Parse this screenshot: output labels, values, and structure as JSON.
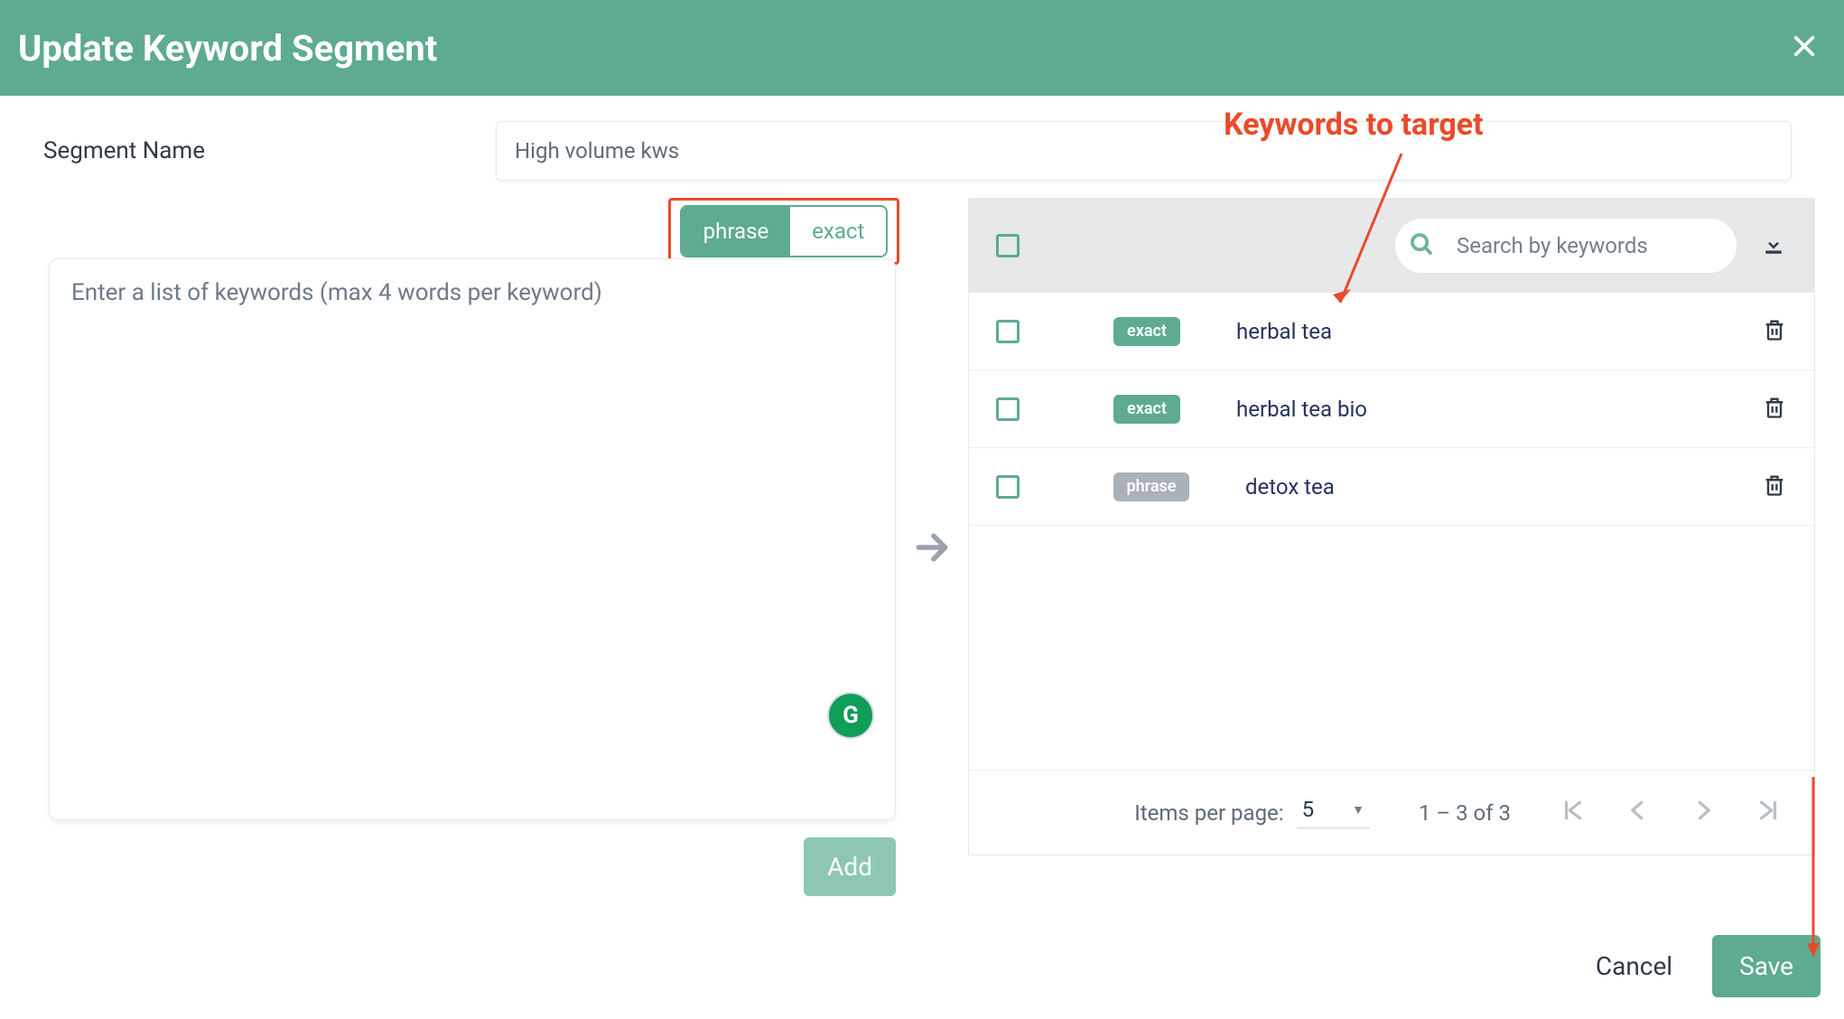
{
  "header": {
    "title": "Update Keyword Segment"
  },
  "segment_name": {
    "label": "Segment Name",
    "value": "High volume kws"
  },
  "match_type_toggle": {
    "phrase_label": "phrase",
    "exact_label": "exact",
    "active": "phrase"
  },
  "keyword_input": {
    "placeholder": "Enter a list of keywords (max 4 words per keyword)",
    "value": ""
  },
  "add_button_label": "Add",
  "keyword_table": {
    "search_placeholder": "Search by keywords",
    "rows": [
      {
        "match": "exact",
        "keyword": "herbal tea"
      },
      {
        "match": "exact",
        "keyword": "herbal tea bio"
      },
      {
        "match": "phrase",
        "keyword": "detox tea"
      }
    ],
    "items_per_page_label": "Items per page:",
    "items_per_page_value": "5",
    "page_info": "1 – 3 of 3"
  },
  "actions": {
    "cancel_label": "Cancel",
    "save_label": "Save"
  },
  "annotations": {
    "keywords_to_target": "Keywords to target"
  }
}
